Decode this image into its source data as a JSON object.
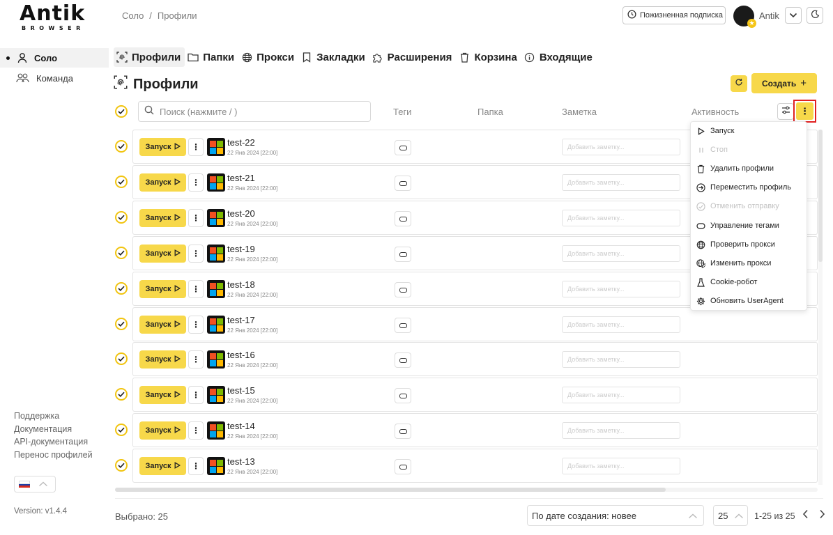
{
  "logo": {
    "wordmark": "Antik",
    "subtitle": "BROWSER"
  },
  "breadcrumb": {
    "root": "Соло",
    "separator": "/",
    "current": "Профили"
  },
  "header": {
    "subscription_label": "Пожизненная подписка",
    "user_name": "Antik"
  },
  "sidebar": {
    "items": [
      {
        "label": "Соло",
        "icon": "user-icon",
        "active": true
      },
      {
        "label": "Команда",
        "icon": "team-icon",
        "active": false
      }
    ],
    "links": [
      "Поддержка",
      "Документация",
      "API-документация",
      "Перенос профилей"
    ],
    "version": "Version: v1.4.4"
  },
  "tabs": [
    {
      "label": "Профили",
      "icon": "fingerprint-icon",
      "active": true
    },
    {
      "label": "Папки",
      "icon": "folder-icon",
      "active": false
    },
    {
      "label": "Прокси",
      "icon": "globe-icon",
      "active": false
    },
    {
      "label": "Закладки",
      "icon": "bookmark-icon",
      "active": false
    },
    {
      "label": "Расширения",
      "icon": "puzzle-icon",
      "active": false
    },
    {
      "label": "Корзина",
      "icon": "trash-icon",
      "active": false
    },
    {
      "label": "Входящие",
      "icon": "info-icon",
      "active": false
    }
  ],
  "page": {
    "title": "Профили",
    "create_label": "Создать"
  },
  "table": {
    "search_placeholder": "Поиск (нажмите / )",
    "columns": {
      "tags": "Теги",
      "folder": "Папка",
      "note": "Заметка",
      "activity": "Активность"
    },
    "launch_label": "Запуск",
    "note_placeholder": "Добавить заметку...",
    "rows": [
      {
        "name": "test-22",
        "date": "22 Янв 2024 [22:00]"
      },
      {
        "name": "test-21",
        "date": "22 Янв 2024 [22:00]"
      },
      {
        "name": "test-20",
        "date": "22 Янв 2024 [22:00]"
      },
      {
        "name": "test-19",
        "date": "22 Янв 2024 [22:00]"
      },
      {
        "name": "test-18",
        "date": "22 Янв 2024 [22:00]"
      },
      {
        "name": "test-17",
        "date": "22 Янв 2024 [22:00]"
      },
      {
        "name": "test-16",
        "date": "22 Янв 2024 [22:00]"
      },
      {
        "name": "test-15",
        "date": "22 Янв 2024 [22:00]"
      },
      {
        "name": "test-14",
        "date": "22 Янв 2024 [22:00]"
      },
      {
        "name": "test-13",
        "date": "22 Янв 2024 [22:00]"
      }
    ]
  },
  "menu": {
    "items": [
      {
        "label": "Запуск",
        "icon": "play-icon",
        "disabled": false
      },
      {
        "label": "Стоп",
        "icon": "pause-icon",
        "disabled": true
      },
      {
        "label": "Удалить профили",
        "icon": "trash-icon",
        "disabled": false
      },
      {
        "label": "Переместить профиль",
        "icon": "move-icon",
        "disabled": false
      },
      {
        "label": "Отменить отправку",
        "icon": "undo-icon",
        "disabled": true
      },
      {
        "label": "Управление тегами",
        "icon": "tag-icon",
        "disabled": false
      },
      {
        "label": "Проверить прокси",
        "icon": "globe-icon",
        "disabled": false
      },
      {
        "label": "Изменить прокси",
        "icon": "globe-edit-icon",
        "disabled": false
      },
      {
        "label": "Cookie-робот",
        "icon": "flask-icon",
        "disabled": false
      },
      {
        "label": "Обновить UserAgent",
        "icon": "gear-icon",
        "disabled": false
      }
    ]
  },
  "footer": {
    "selected_text": "Выбрано: 25",
    "sort_value": "По дате создания: новее",
    "per_page": "25",
    "range_text": "1-25 из 25"
  },
  "colors": {
    "accent": "#f7d84a",
    "check": "#f1c40f",
    "highlight": "#e02020"
  }
}
